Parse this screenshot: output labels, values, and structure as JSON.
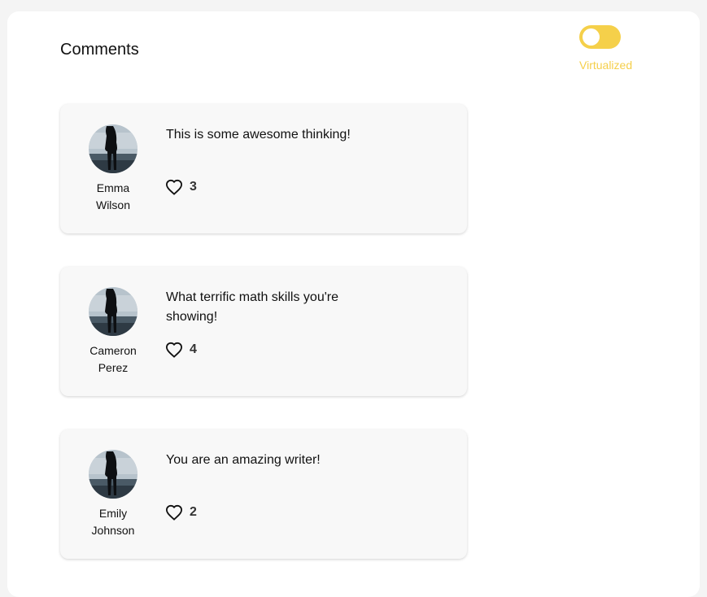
{
  "header": {
    "title": "Comments"
  },
  "toggle": {
    "label": "Virtualized",
    "on": false,
    "color": "#f5d04a"
  },
  "comments": [
    {
      "first_name": "Emma",
      "last_name": "Wilson",
      "text": "This is some awesome thinking!",
      "likes": "3"
    },
    {
      "first_name": "Cameron",
      "last_name": "Perez",
      "text": "What terrific math skills you're showing!",
      "likes": "4"
    },
    {
      "first_name": "Emily",
      "last_name": "Johnson",
      "text": "You are an amazing writer!",
      "likes": "2"
    }
  ],
  "icons": {
    "like": "heart-outline-icon",
    "avatar": "person-photo"
  }
}
